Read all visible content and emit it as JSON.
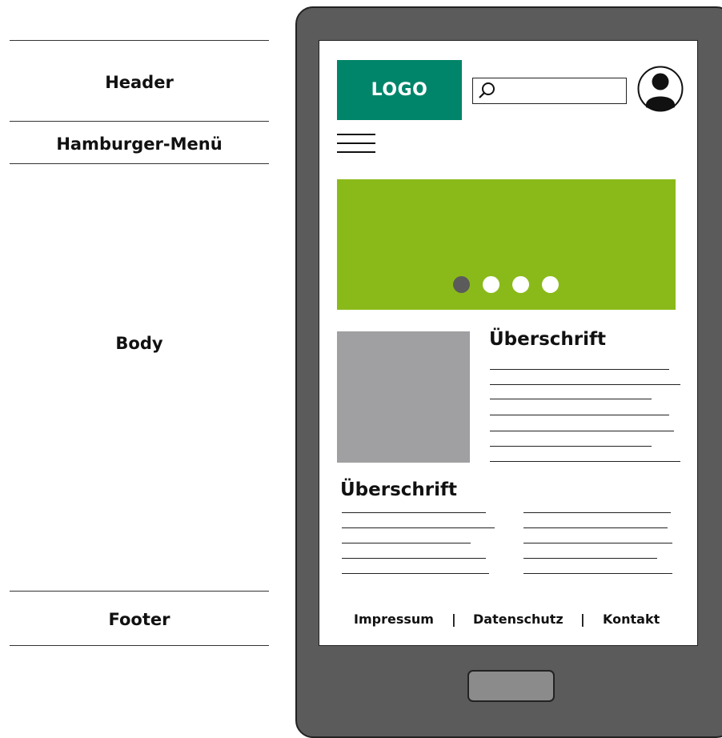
{
  "labels": {
    "header": "Header",
    "hamburger_menu": "Hamburger-Menü",
    "body": "Body",
    "footer": "Footer"
  },
  "screen": {
    "logo_text": "LOGO",
    "search": {
      "icon": "search-icon",
      "value": ""
    },
    "user_icon": "user-avatar-icon",
    "menu_icon": "hamburger-icon",
    "slider": {
      "total_slides": 4,
      "active_slide": 1
    },
    "section_1_heading": "Überschrift",
    "section_2_heading": "Überschrift",
    "footer": {
      "links": [
        "Impressum",
        "Datenschutz",
        "Kontakt"
      ],
      "separator": "|"
    }
  },
  "colors": {
    "logo_bg": "#00856a",
    "slider_bg": "#8aba1a",
    "dot_active": "#5b5b5b",
    "dot_inactive": "#ffffff",
    "image_placeholder": "#a0a0a2",
    "device_body": "#5b5b5b",
    "home_button": "#8b8b8b"
  }
}
